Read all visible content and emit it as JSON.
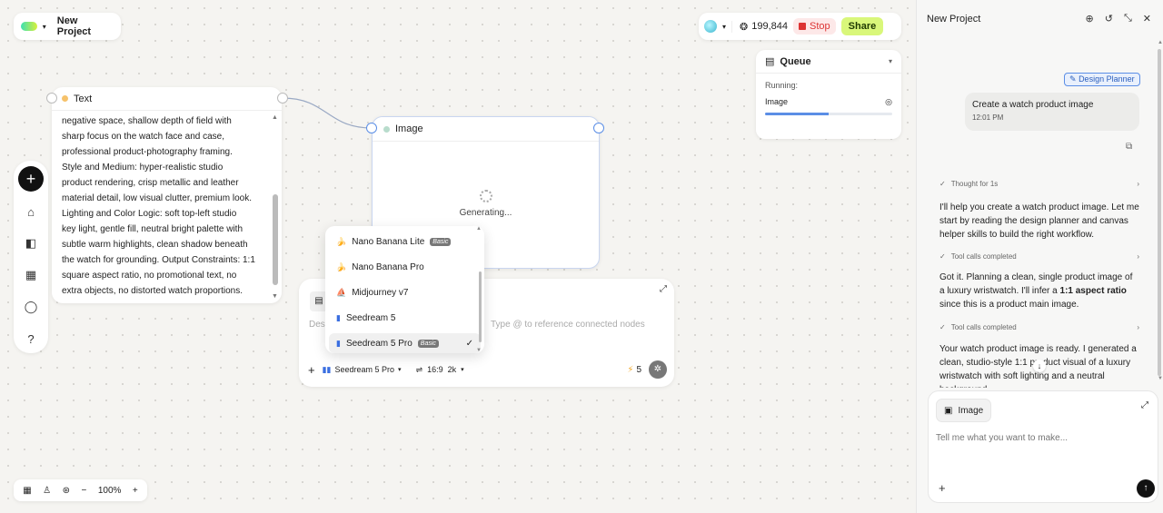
{
  "project": {
    "title": "New Project"
  },
  "topbar": {
    "credits": "199,844",
    "stop_label": "Stop",
    "share_label": "Share"
  },
  "queue": {
    "title": "Queue",
    "running_label": "Running:",
    "job_label": "Image",
    "progress": 0.5
  },
  "text_node": {
    "label": "Text",
    "lines": [
      "negative space, shallow depth of field with",
      "sharp focus on the watch face and case,",
      "professional product-photography framing.",
      "Style and Medium: hyper-realistic studio",
      "product rendering, crisp metallic and leather",
      "material detail, low visual clutter, premium look.",
      "Lighting and Color Logic: soft top-left studio",
      "key light, gentle fill, neutral bright palette with",
      "subtle warm highlights, clean shadow beneath",
      "the watch for grounding. Output Constraints: 1:1",
      "square aspect ratio, no promotional text, no",
      "extra objects, no distorted watch proportions."
    ]
  },
  "image_node": {
    "label": "Image",
    "status": "Generating..."
  },
  "composer": {
    "desc_label": "Des",
    "placeholder": "Type @ to reference connected nodes",
    "model": "Seedream 5 Pro",
    "ratio": "16:9",
    "resolution": "2k",
    "cost": "5"
  },
  "dropdown": {
    "options": [
      {
        "label": "Nano Banana Lite",
        "badge": "Basic",
        "icon": "banana-icon"
      },
      {
        "label": "Nano Banana Pro",
        "badge": "",
        "icon": "banana-icon"
      },
      {
        "label": "Midjourney v7",
        "badge": "",
        "icon": "sail-icon"
      },
      {
        "label": "Seedream 5",
        "badge": "",
        "icon": "bars-icon"
      },
      {
        "label": "Seedream 5 Pro",
        "badge": "Basic",
        "icon": "bars-icon",
        "selected": true
      }
    ]
  },
  "zoom": {
    "level": "100%"
  },
  "panel": {
    "title": "New Project",
    "badge": "Design Planner",
    "user_msg": "Create a watch product image",
    "user_time": "12:01 PM",
    "steps": [
      "Thought for 1s",
      "Tool calls completed",
      "Tool calls completed"
    ],
    "para1": "I'll help you create a watch product image. Let me start by reading the design planner and canvas helper skills to build the right workflow.",
    "para2_a": "Got it. Planning a clean, single product image of a luxury wristwatch. I'll infer a ",
    "para2_b": "1:1 aspect ratio",
    "para2_c": " since this is a product main image.",
    "para3": "Your watch product image is ready. I generated a clean, studio-style 1:1 product visual of a luxury wristwatch with soft lighting and a neutral background.",
    "chip": "Image",
    "input_placeholder": "Tell me what you want to make..."
  },
  "colors": {
    "accent": "#5b8ee6",
    "share": "#d9f77a",
    "stop": "#dd3333"
  }
}
